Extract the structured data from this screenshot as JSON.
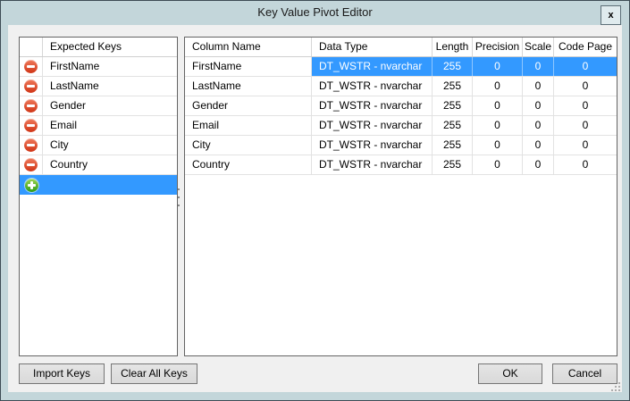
{
  "window": {
    "title": "Key Value Pivot Editor",
    "close_label": "x"
  },
  "colors": {
    "titlebar_frame": "#c3d6da",
    "client_background": "#f0f0f0",
    "selection_blue": "#3399ff",
    "remove_icon_red": "#d03415",
    "add_icon_green": "#2f9e15"
  },
  "left_panel": {
    "header": "Expected Keys",
    "remove_icon_name": "remove-key-icon",
    "add_icon_name": "add-key-icon",
    "keys": [
      "FirstName",
      "LastName",
      "Gender",
      "Email",
      "City",
      "Country"
    ],
    "new_key_value": ""
  },
  "right_panel": {
    "columns": [
      "Column Name",
      "Data Type",
      "Length",
      "Precision",
      "Scale",
      "Code Page"
    ],
    "rows": [
      {
        "column_name": "FirstName",
        "data_type": "DT_WSTR - nvarchar",
        "length": "255",
        "precision": "0",
        "scale": "0",
        "code_page": "0",
        "selected": true
      },
      {
        "column_name": "LastName",
        "data_type": "DT_WSTR - nvarchar",
        "length": "255",
        "precision": "0",
        "scale": "0",
        "code_page": "0",
        "selected": false
      },
      {
        "column_name": "Gender",
        "data_type": "DT_WSTR - nvarchar",
        "length": "255",
        "precision": "0",
        "scale": "0",
        "code_page": "0",
        "selected": false
      },
      {
        "column_name": "Email",
        "data_type": "DT_WSTR - nvarchar",
        "length": "255",
        "precision": "0",
        "scale": "0",
        "code_page": "0",
        "selected": false
      },
      {
        "column_name": "City",
        "data_type": "DT_WSTR - nvarchar",
        "length": "255",
        "precision": "0",
        "scale": "0",
        "code_page": "0",
        "selected": false
      },
      {
        "column_name": "Country",
        "data_type": "DT_WSTR - nvarchar",
        "length": "255",
        "precision": "0",
        "scale": "0",
        "code_page": "0",
        "selected": false
      }
    ]
  },
  "buttons": {
    "import": "Import Keys",
    "clear": "Clear All Keys",
    "ok": "OK",
    "cancel": "Cancel"
  }
}
